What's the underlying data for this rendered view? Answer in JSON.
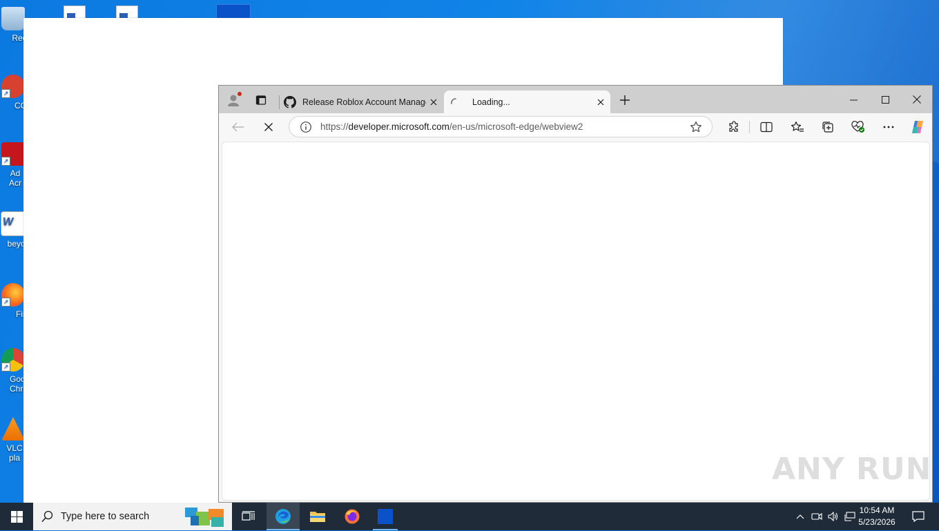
{
  "desktop": {
    "icons": [
      {
        "label": "Recy",
        "icon": "recycle-bin-icon"
      },
      {
        "label": "CCl",
        "icon": "ccleaner-icon"
      },
      {
        "label": "Ad Acr",
        "icon": "adobe-acrobat-icon"
      },
      {
        "label": "beyon",
        "icon": "word-document-icon"
      },
      {
        "label": "Fir",
        "icon": "firefox-icon"
      },
      {
        "label": "Goo Chr",
        "icon": "chrome-icon"
      },
      {
        "label": "VLC plа",
        "icon": "vlc-icon"
      }
    ]
  },
  "browser": {
    "tabs": [
      {
        "title": "Release Roblox Account Manager",
        "icon": "github-icon",
        "active": false
      },
      {
        "title": "Loading...",
        "icon": "loading-spinner-icon",
        "active": true
      }
    ],
    "address": {
      "prefix": "https://",
      "host": "developer.microsoft.com",
      "path": "/en-us/microsoft-edge/webview2"
    }
  },
  "watermark": "ANY RUN",
  "taskbar": {
    "search_placeholder": "Type here to search",
    "time": "10:54 AM",
    "date": "5/23/2026"
  }
}
